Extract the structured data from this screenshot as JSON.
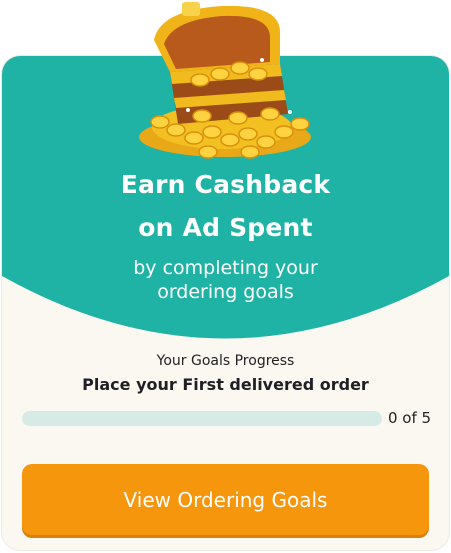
{
  "colors": {
    "teal": "#1fb3a5",
    "cream": "#fbf7f1",
    "progress_track": "#d7ebe6",
    "progress_fill": "#18b2a3",
    "cta": "#f5960d"
  },
  "hero": {
    "image_icon": "treasure-chest-icon",
    "headline_line1": "Earn Cashback",
    "headline_line2": "on Ad Spent",
    "subtitle_line1": "by completing your",
    "subtitle_line2": "ordering goals"
  },
  "progress": {
    "label": "Your Goals Progress",
    "goal_title": "Place your First delivered order",
    "count_text": "0 of 5",
    "completed": 0,
    "total": 5
  },
  "cta": {
    "label": "View Ordering Goals"
  }
}
